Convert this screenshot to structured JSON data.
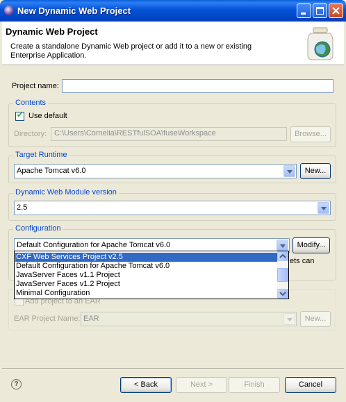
{
  "window": {
    "title": "New Dynamic Web Project"
  },
  "banner": {
    "title": "Dynamic Web Project",
    "description": "Create a standalone Dynamic Web project or add it to a new or existing Enterprise Application."
  },
  "project": {
    "name_label": "Project name:",
    "name_value": ""
  },
  "contents": {
    "group_label": "Contents",
    "use_default_label": "Use default",
    "use_default_checked": true,
    "directory_label": "Directory:",
    "directory_value": "C:\\Users\\Cornelia\\RESTfulSOA\\fuseWorkspace",
    "browse_label": "Browse..."
  },
  "target_runtime": {
    "group_label": "Target Runtime",
    "value": "Apache Tomcat v6.0",
    "new_label": "New..."
  },
  "module_version": {
    "group_label": "Dynamic Web Module version",
    "value": "2.5"
  },
  "configuration": {
    "group_label": "Configuration",
    "value": "Default Configuration for Apache Tomcat v6.0",
    "modify_label": "Modify...",
    "hidden_text_fragment": "ets can",
    "options": [
      "CXF Web Services Project v2.5",
      "Default Configuration for Apache Tomcat v6.0",
      "JavaServer Faces v1.1 Project",
      "JavaServer Faces v1.2 Project",
      "Minimal Configuration"
    ],
    "selected_index": 0
  },
  "ear": {
    "add_label": "Add project to an EAR",
    "project_name_label": "EAR Project Name:",
    "project_name_value": "EAR",
    "new_label": "New..."
  },
  "buttons": {
    "help": "?",
    "back": "< Back",
    "next": "Next >",
    "finish": "Finish",
    "cancel": "Cancel"
  },
  "colors": {
    "titlebar": "#0553d6",
    "group_label": "#0046d5",
    "selection": "#316ac5"
  }
}
